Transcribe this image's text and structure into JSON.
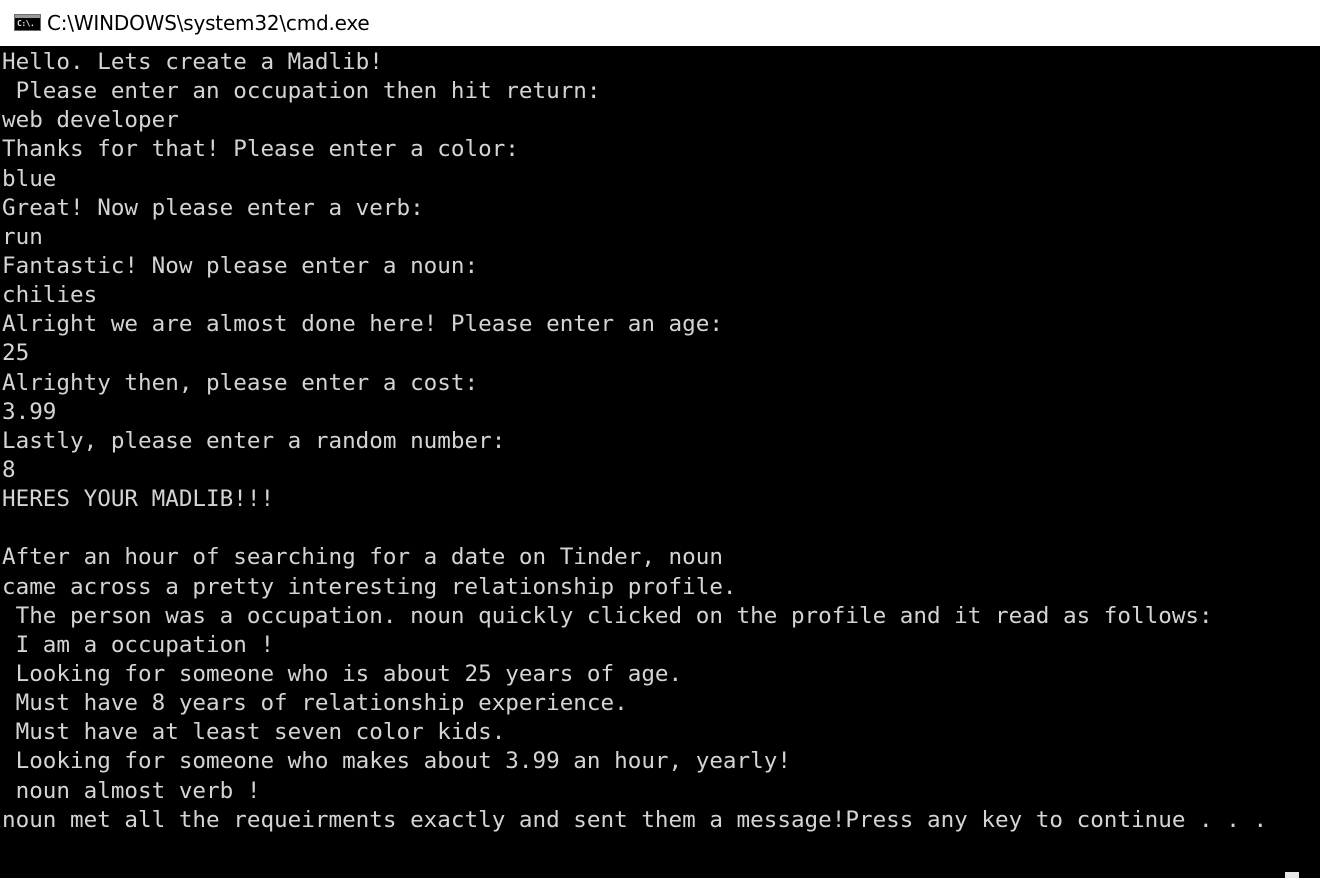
{
  "window": {
    "title": "C:\\WINDOWS\\system32\\cmd.exe",
    "icon_label": "C:\\."
  },
  "console": {
    "background_color": "#000000",
    "text_color": "#d4d4d4",
    "lines": [
      "Hello. Lets create a Madlib!",
      " Please enter an occupation then hit return:",
      "web developer",
      "Thanks for that! Please enter a color:",
      "blue",
      "Great! Now please enter a verb:",
      "run",
      "Fantastic! Now please enter a noun:",
      "chilies",
      "Alright we are almost done here! Please enter an age:",
      "25",
      "Alrighty then, please enter a cost:",
      "3.99",
      "Lastly, please enter a random number:",
      "8",
      "HERES YOUR MADLIB!!!",
      "",
      "After an hour of searching for a date on Tinder, noun",
      "came across a pretty interesting relationship profile.",
      " The person was a occupation. noun quickly clicked on the profile and it read as follows:",
      " I am a occupation !",
      " Looking for someone who is about 25 years of age.",
      " Must have 8 years of relationship experience.",
      " Must have at least seven color kids.",
      " Looking for someone who makes about 3.99 an hour, yearly!",
      " noun almost verb !",
      "noun met all the requeirments exactly and sent them a message!Press any key to continue . . ."
    ]
  }
}
